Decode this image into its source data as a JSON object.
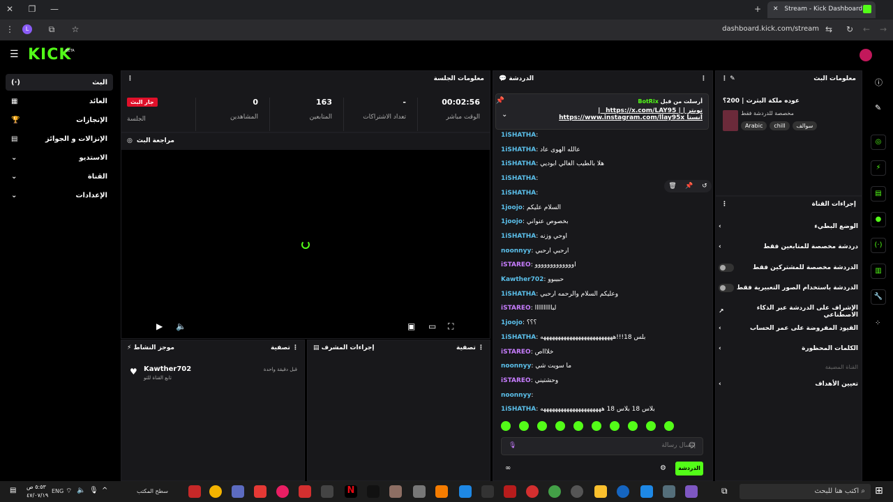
{
  "browser": {
    "tab_title": "Stream - Kick Dashboard",
    "url": "dashboard.kick.com/stream"
  },
  "brand": {
    "logo": "KICK",
    "beta": "BETA"
  },
  "leftnav": [
    "البث",
    "العائد",
    "الإنجازات",
    "الإنزالات و الجوائز",
    "الاستديو",
    "القناة",
    "الإعدادات"
  ],
  "session": {
    "title": "معلومات الجلسة",
    "live_badge": "جار البث",
    "session_label": "الجلسة",
    "stats": [
      {
        "v": "00:02:56",
        "l": "الوقت مباشر"
      },
      {
        "v": "-",
        "l": "تعداد الاشتراكات"
      },
      {
        "v": "163",
        "l": "المتابعين"
      },
      {
        "v": "0",
        "l": "المشاهدين"
      }
    ]
  },
  "preview": {
    "title": "مراجعة البث"
  },
  "activity": {
    "title": "موجز النشاط",
    "filter": "تصفية",
    "user": "Kawther702",
    "action": "تابع القناة للتو",
    "time": "قبل دقيقة واحدة"
  },
  "modactions": {
    "title": "إجراءات المشرف",
    "filter": "تصفية"
  },
  "chat": {
    "title": "الدردشة",
    "pinned_by": "BotRix",
    "pinned_label": "أرسلت من قبل",
    "pinned_text1": "تويتر | | https://x.com/LAY95_ |",
    "pinned_text2": "انستا https://www.instagram.com/llay95x",
    "messages": [
      {
        "u": "1iSHATHA",
        "c": "#5bc0eb",
        "t": ""
      },
      {
        "u": "1iSHATHA",
        "c": "#5bc0eb",
        "t": "عالله الهوى عاد"
      },
      {
        "u": "1iSHATHA",
        "c": "#5bc0eb",
        "t": "هلا بالطيب الغالي ابوديي"
      },
      {
        "u": "1iSHATHA",
        "c": "#5bc0eb",
        "t": ""
      },
      {
        "u": "1iSHATHA",
        "c": "#5bc0eb",
        "t": ""
      },
      {
        "u": "1joojo",
        "c": "#5bc0eb",
        "t": "السلام عليكم"
      },
      {
        "u": "1joojo",
        "c": "#5bc0eb",
        "t": "بخصوص عنواني"
      },
      {
        "u": "1iSHATHA",
        "c": "#5bc0eb",
        "t": "اوحي وزنه"
      },
      {
        "u": "noonnyy",
        "c": "#5bc0eb",
        "t": "ارحبي ارحبي"
      },
      {
        "u": "iSTAREO",
        "c": "#c77dff",
        "t": "اووووووووووووو"
      },
      {
        "u": "Kawther702",
        "c": "#5bc0eb",
        "t": "حبيبوو"
      },
      {
        "u": "1iSHATHA",
        "c": "#5bc0eb",
        "t": "وعليكم السلام والرحمه ارحبي"
      },
      {
        "u": "iSTAREO",
        "c": "#c77dff",
        "t": "لباااااااااا"
      },
      {
        "u": "1joojo",
        "c": "#5bc0eb",
        "t": "؟؟؟"
      },
      {
        "u": "1iSHATHA",
        "c": "#5bc0eb",
        "t": "بلس 18!!!هههههههههههههههههههههههههه"
      },
      {
        "u": "iSTAREO",
        "c": "#c77dff",
        "t": "خلاااص"
      },
      {
        "u": "noonnyy",
        "c": "#5bc0eb",
        "t": "ما سويت شي"
      },
      {
        "u": "iSTAREO",
        "c": "#c77dff",
        "t": "وحشتيني"
      },
      {
        "u": "noonnyy",
        "c": "#5bc0eb",
        "t": ""
      },
      {
        "u": "1iSHATHA",
        "c": "#5bc0eb",
        "t": "بلاس 18 بلاس 18 هههههههههههههههههههههه"
      }
    ],
    "input_placeholder": "إرسال رسالة",
    "send": "الدردشة"
  },
  "streaminfo": {
    "title": "معلومات البث",
    "stream_title": "عوده ملكة البثرث | 200؟",
    "category": "مخصصة للدردشة فقط",
    "tags": [
      "Arabic",
      "chill",
      "سوالف"
    ]
  },
  "channelactions": {
    "title": "إجراءات القناة",
    "items": [
      "الوضع البطيء",
      "دردشة مخصصة للمتابعين فقط",
      "الدردشة مخصصة للمشتركين فقط",
      "الدردشة باستخدام الصور التعبيرية فقط",
      "الإشراف على الدردشة عبر الذكاء الاصطناعي",
      "القيود المفروضة على عمر الحساب",
      "الكلمات المحظورة",
      "القناة المضيفة",
      "تعيين الأهداف"
    ]
  },
  "taskbar": {
    "search": "اكتب هنا للبحث",
    "desktop": "سطح المكتب",
    "lang": "ENG",
    "time": "٥:٥٣ ص",
    "date": "٤٧/٠٧/١٩"
  }
}
